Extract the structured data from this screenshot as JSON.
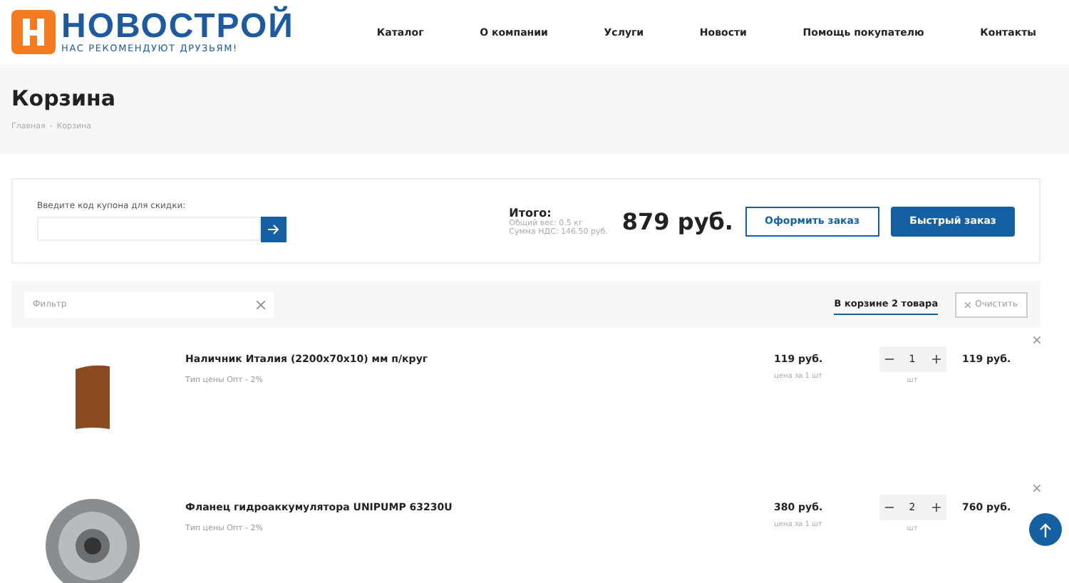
{
  "logo": {
    "name": "НОВОСТРОЙ",
    "tagline": "НАС РЕКОМЕНДУЮТ ДРУЗЬЯМ!"
  },
  "nav": [
    "Каталог",
    "О компании",
    "Услуги",
    "Новости",
    "Помощь покупателю",
    "Контакты"
  ],
  "page_title": "Корзина",
  "breadcrumbs": [
    "Главная",
    "-",
    "Корзина"
  ],
  "coupon": {
    "label": "Введите код купона для скидки:"
  },
  "summary": {
    "label": "Итого:",
    "weight": "Общий вес: 0.5 кг",
    "vat": "Сумма НДС: 146.50 руб.",
    "total": "879 руб.",
    "checkout": "Оформить заказ",
    "quick_order": "Быстрый заказ"
  },
  "filter": {
    "placeholder": "Фильтр",
    "count_tab": "В корзине 2 товара",
    "clear": "Очистить"
  },
  "items": [
    {
      "kind": "trim",
      "name": "Наличник Италия (2200х70х10) мм п/круг",
      "price_type": "Тип цены Опт - 2%",
      "price": "119 руб.",
      "price_note": "цена за 1 шт",
      "qty": "1",
      "unit": "шт",
      "sum": "119 руб."
    },
    {
      "kind": "flange",
      "name": "Фланец гидроаккумулятора UNIPUMP 63230U",
      "price_type": "Тип цены Опт - 2%",
      "price": "380 руб.",
      "price_note": "цена за 1 шт",
      "qty": "2",
      "unit": "шт",
      "sum": "760 руб."
    }
  ]
}
